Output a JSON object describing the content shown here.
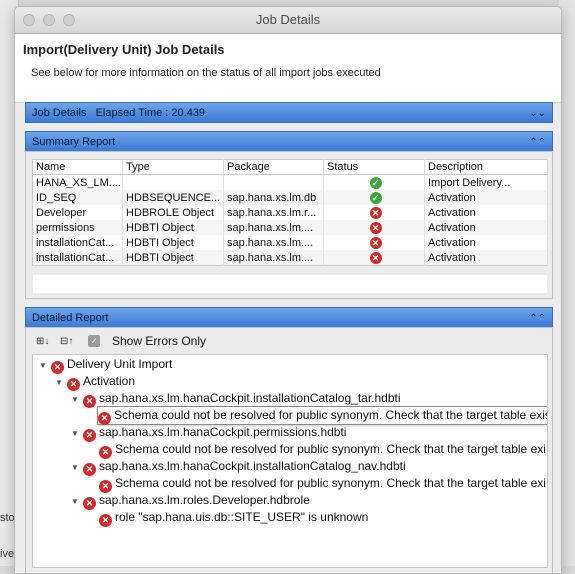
{
  "window": {
    "title": "Job Details"
  },
  "header": {
    "title": "Import(Delivery Unit) Job Details",
    "subtitle": "See below for more information on the status of all import jobs executed"
  },
  "job_details": {
    "label": "Job Details",
    "elapsed_label": "Elapsed Time : 20.439"
  },
  "summary": {
    "label": "Summary Report",
    "columns": [
      "Name",
      "Type",
      "Package",
      "Status",
      "Description"
    ],
    "rows": [
      {
        "name": "HANA_XS_LM....",
        "type": "",
        "package": "",
        "status": "success",
        "description": "Import Delivery..."
      },
      {
        "name": "ID_SEQ",
        "type": "HDBSEQUENCE...",
        "package": "sap.hana.xs.lm.db",
        "status": "success",
        "description": "Activation"
      },
      {
        "name": "Developer",
        "type": "HDBROLE Object",
        "package": "sap.hana.xs.lm.r...",
        "status": "error",
        "description": "Activation"
      },
      {
        "name": "permissions",
        "type": "HDBTI Object",
        "package": "sap.hana.xs.lm....",
        "status": "error",
        "description": "Activation"
      },
      {
        "name": "installationCat...",
        "type": "HDBTI Object",
        "package": "sap.hana.xs.lm....",
        "status": "error",
        "description": "Activation"
      },
      {
        "name": "installationCat...",
        "type": "HDBTI Object",
        "package": "sap.hana.xs.lm....",
        "status": "error",
        "description": "Activation"
      }
    ]
  },
  "detailed": {
    "label": "Detailed Report",
    "show_errors_only": "Show Errors Only",
    "tree": [
      "Delivery Unit Import",
      "Activation",
      "sap.hana.xs.lm.hanaCockpit.installationCatalog_tar.hdbti",
      "Schema could not be resolved for public synonym.  Check that the target table exists.",
      "sap.hana.xs.lm.hanaCockpit.permissions.hdbti",
      "Schema could not be resolved for public synonym.  Check that the target table exi",
      "sap.hana.xs.lm.hanaCockpit.installationCatalog_nav.hdbti",
      "Schema could not be resolved for public synonym.  Check that the target table exi",
      "sap.hana.xs.lm.roles.Developer.hdbrole",
      "role \"sap.hana.uis.db::SITE_USER\" is unknown"
    ]
  },
  "background": {
    "snip1": "sto",
    "snip2": "ive"
  },
  "colors": {
    "section_bar": "#3a7ad6",
    "success": "#38a83a",
    "error": "#d72727"
  },
  "icons": {
    "success": "check-circle-icon",
    "error": "x-circle-icon"
  }
}
